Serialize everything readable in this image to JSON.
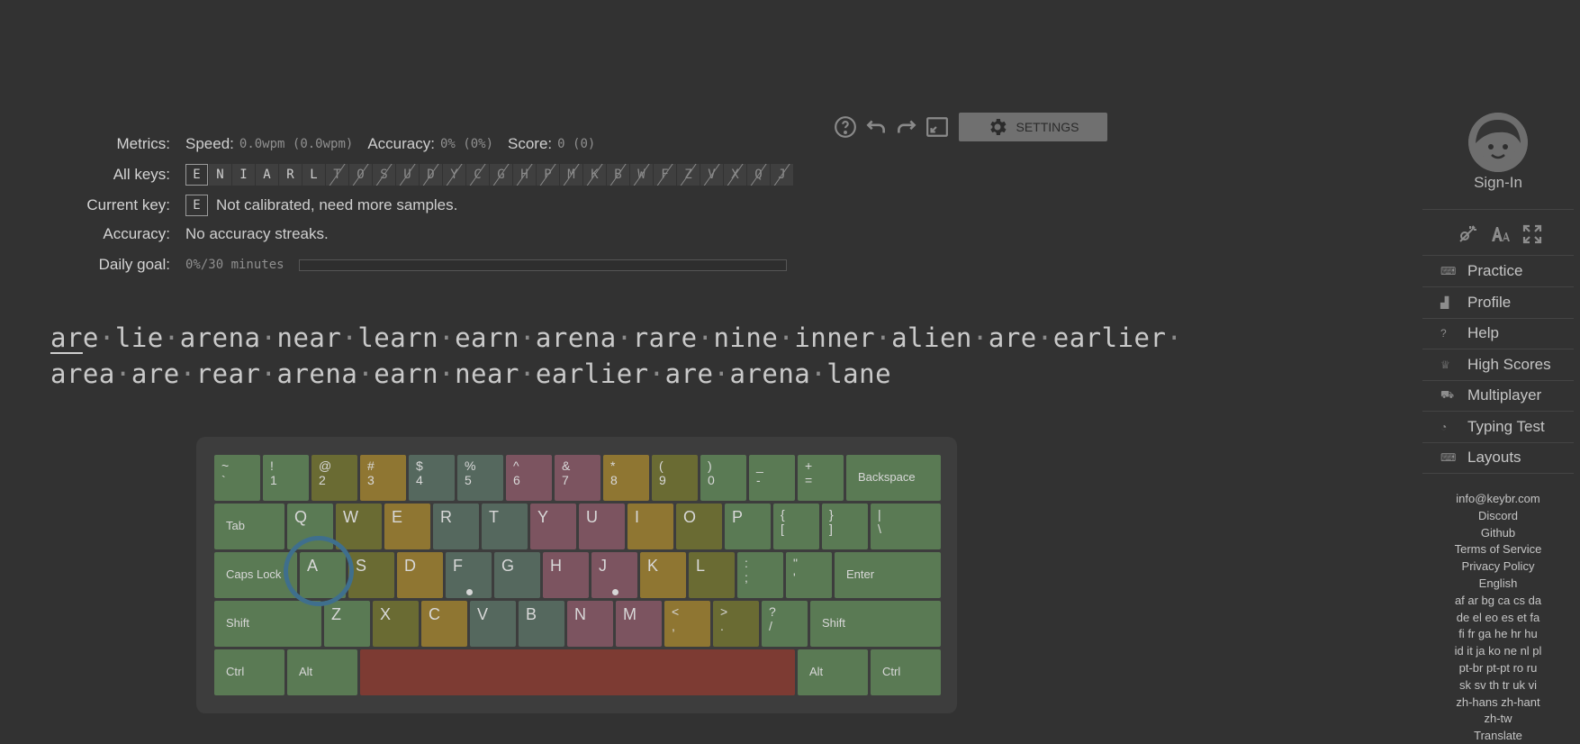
{
  "toolbar": {
    "settings_label": "SETTINGS"
  },
  "metrics": {
    "metrics_label": "Metrics:",
    "speed_label": "Speed:",
    "speed_value": "0.0wpm",
    "speed_value2": "0.0wpm",
    "accuracy_label": "Accuracy:",
    "accuracy_value": "0%",
    "accuracy_value2": "0%",
    "score_label": "Score:",
    "score_value": "0",
    "score_value2": "0",
    "all_keys_label": "All keys:",
    "all_keys": [
      "E",
      "N",
      "I",
      "A",
      "R",
      "L",
      "T",
      "O",
      "S",
      "U",
      "D",
      "Y",
      "C",
      "G",
      "H",
      "P",
      "M",
      "K",
      "B",
      "W",
      "F",
      "Z",
      "V",
      "X",
      "Q",
      "J"
    ],
    "unlocked_count": 6,
    "current_key_label": "Current key:",
    "current_key": "E",
    "current_key_status": "Not calibrated, need more samples.",
    "accuracy_row_label": "Accuracy:",
    "accuracy_row_text": "No accuracy streaks.",
    "daily_goal_label": "Daily goal:",
    "daily_goal_text": "0%/30 minutes",
    "daily_goal_progress": 0
  },
  "text": {
    "line1": [
      "are",
      "lie",
      "arena",
      "near",
      "learn",
      "earn",
      "arena",
      "rare",
      "nine",
      "inner",
      "alien",
      "are",
      "earlier"
    ],
    "line2": [
      "area",
      "are",
      "rear",
      "arena",
      "earn",
      "near",
      "earlier",
      "are",
      "arena",
      "lane"
    ],
    "separator": "·"
  },
  "keyboard": {
    "row1": [
      {
        "s": "~",
        "u": "`",
        "c": "g"
      },
      {
        "s": "!",
        "u": "1",
        "c": "g"
      },
      {
        "s": "@",
        "u": "2",
        "c": "o"
      },
      {
        "s": "#",
        "u": "3",
        "c": "y"
      },
      {
        "s": "$",
        "u": "4",
        "c": "t"
      },
      {
        "s": "%",
        "u": "5",
        "c": "t"
      },
      {
        "s": "^",
        "u": "6",
        "c": "p"
      },
      {
        "s": "&",
        "u": "7",
        "c": "p"
      },
      {
        "s": "*",
        "u": "8",
        "c": "y"
      },
      {
        "s": "(",
        "u": "9",
        "c": "o"
      },
      {
        "s": ")",
        "u": "0",
        "c": "g"
      },
      {
        "s": "_",
        "u": "-",
        "c": "g"
      },
      {
        "s": "+",
        "u": "=",
        "c": "g"
      }
    ],
    "backspace": "Backspace",
    "tab": "Tab",
    "row2": [
      {
        "k": "Q",
        "c": "g"
      },
      {
        "k": "W",
        "c": "o"
      },
      {
        "k": "E",
        "c": "y"
      },
      {
        "k": "R",
        "c": "t"
      },
      {
        "k": "T",
        "c": "t"
      },
      {
        "k": "Y",
        "c": "p"
      },
      {
        "k": "U",
        "c": "p"
      },
      {
        "k": "I",
        "c": "y"
      },
      {
        "k": "O",
        "c": "o"
      },
      {
        "k": "P",
        "c": "g"
      },
      {
        "s": "{",
        "u": "[",
        "c": "g"
      },
      {
        "s": "}",
        "u": "]",
        "c": "g"
      }
    ],
    "pipe": {
      "s": "|",
      "u": "\\"
    },
    "caps": "Caps Lock",
    "row3": [
      {
        "k": "A",
        "c": "g"
      },
      {
        "k": "S",
        "c": "o"
      },
      {
        "k": "D",
        "c": "y"
      },
      {
        "k": "F",
        "c": "t"
      },
      {
        "k": "G",
        "c": "t"
      },
      {
        "k": "H",
        "c": "p"
      },
      {
        "k": "J",
        "c": "p"
      },
      {
        "k": "K",
        "c": "y"
      },
      {
        "k": "L",
        "c": "o"
      },
      {
        "s": ":",
        "u": ";",
        "c": "g"
      },
      {
        "s": "\"",
        "u": "'",
        "c": "g"
      }
    ],
    "enter": "Enter",
    "shift": "Shift",
    "row4": [
      {
        "k": "Z",
        "c": "g"
      },
      {
        "k": "X",
        "c": "o"
      },
      {
        "k": "C",
        "c": "y"
      },
      {
        "k": "V",
        "c": "t"
      },
      {
        "k": "B",
        "c": "t"
      },
      {
        "k": "N",
        "c": "p"
      },
      {
        "k": "M",
        "c": "p"
      },
      {
        "s": "<",
        "u": ",",
        "c": "y"
      },
      {
        "s": ">",
        "u": ".",
        "c": "o"
      },
      {
        "s": "?",
        "u": "/",
        "c": "g"
      }
    ],
    "shift_right": "Shift",
    "ctrl": "Ctrl",
    "alt": "Alt",
    "alt_right": "Alt",
    "ctrl_right": "Ctrl",
    "colors": {
      "g": "#5a7a54",
      "o": "#6a6b33",
      "y": "#8f7632",
      "t": "#55685e",
      "p": "#7c5460",
      "r": "#7d3b33"
    }
  },
  "sidebar": {
    "signin": "Sign-In",
    "nav": [
      {
        "label": "Practice",
        "icon": "keyboard-icon"
      },
      {
        "label": "Profile",
        "icon": "chart-icon"
      },
      {
        "label": "Help",
        "icon": "help-icon"
      },
      {
        "label": "High Scores",
        "icon": "trophy-icon"
      },
      {
        "label": "Multiplayer",
        "icon": "car-icon"
      },
      {
        "label": "Typing Test",
        "icon": "gauge-icon"
      },
      {
        "label": "Layouts",
        "icon": "keyboard-icon"
      }
    ],
    "footer": [
      "info@keybr.com",
      "Discord",
      "Github",
      "Terms of Service",
      "Privacy Policy",
      "English",
      "af ar bg ca cs da",
      "de el eo es et fa",
      "fi fr ga he hr hu",
      "id it ja ko ne nl pl",
      "pt-br pt-pt ro ru",
      "sk sv th tr uk vi",
      "zh-hans zh-hant",
      "zh-tw",
      "Translate"
    ]
  }
}
